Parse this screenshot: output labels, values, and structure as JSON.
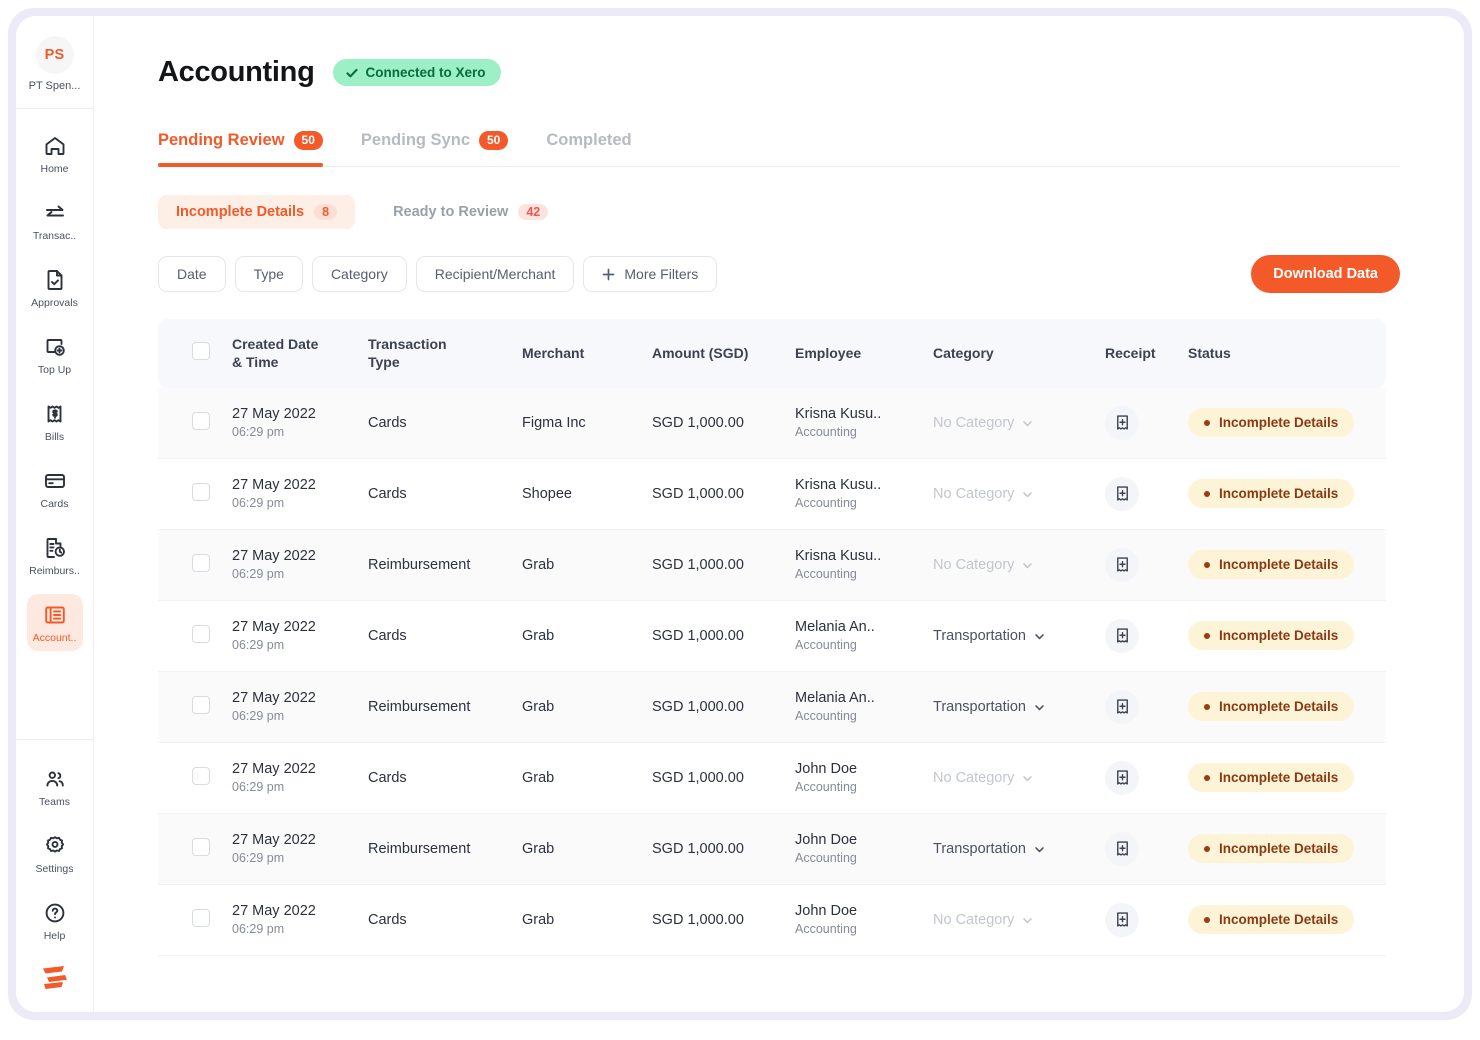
{
  "sidebar": {
    "org": {
      "initials": "PS",
      "name": "PT Spen..."
    },
    "items": [
      {
        "label": "Home",
        "icon": "home-icon",
        "active": false
      },
      {
        "label": "Transac..",
        "icon": "transfer-icon",
        "active": false
      },
      {
        "label": "Approvals",
        "icon": "document-check-icon",
        "active": false
      },
      {
        "label": "Top Up",
        "icon": "wallet-plus-icon",
        "active": false
      },
      {
        "label": "Bills",
        "icon": "receipt-dollar-icon",
        "active": false
      },
      {
        "label": "Cards",
        "icon": "card-icon",
        "active": false
      },
      {
        "label": "Reimburs..",
        "icon": "document-clock-icon",
        "active": false
      },
      {
        "label": "Account..",
        "icon": "accounting-icon",
        "active": true
      }
    ],
    "bottom_items": [
      {
        "label": "Teams",
        "icon": "people-icon"
      },
      {
        "label": "Settings",
        "icon": "gear-icon"
      },
      {
        "label": "Help",
        "icon": "help-circle-icon"
      }
    ],
    "brand": "spenmo-logo"
  },
  "header": {
    "title": "Accounting",
    "connection_badge": {
      "label": "Connected to Xero",
      "icon": "check-icon"
    }
  },
  "tabs": [
    {
      "label": "Pending Review",
      "count": "50",
      "active": true
    },
    {
      "label": "Pending Sync",
      "count": "50",
      "active": false
    },
    {
      "label": "Completed",
      "count": "",
      "active": false
    }
  ],
  "subtabs": [
    {
      "label": "Incomplete Details",
      "count": "8",
      "active": true
    },
    {
      "label": "Ready to Review",
      "count": "42",
      "active": false
    }
  ],
  "filters": [
    {
      "label": "Date",
      "icon": ""
    },
    {
      "label": "Type",
      "icon": ""
    },
    {
      "label": "Category",
      "icon": ""
    },
    {
      "label": "Recipient/Merchant",
      "icon": ""
    },
    {
      "label": "More Filters",
      "icon": "plus-icon"
    }
  ],
  "download_button": "Download Data",
  "table": {
    "columns": [
      "",
      "Created Date & Time",
      "Transaction Type",
      "Merchant",
      "Amount (SGD)",
      "Employee",
      "Category",
      "Receipt",
      "Status"
    ],
    "column_lines": {
      "created_date": [
        "Created Date",
        "& Time"
      ],
      "transaction_type": [
        "Transaction",
        "Type"
      ],
      "merchant": "Merchant",
      "amount": "Amount (SGD)",
      "employee": "Employee",
      "category": "Category",
      "receipt": "Receipt",
      "status": "Status"
    },
    "rows": [
      {
        "date": "27 May 2022",
        "time": "06:29 pm",
        "type": "Cards",
        "merchant": "Figma Inc",
        "amount": "SGD 1,000.00",
        "employee": "Krisna Kusu..",
        "dept": "Accounting",
        "category": "No Category",
        "category_empty": true,
        "receipt_icon": "add-receipt-icon",
        "status": "Incomplete Details"
      },
      {
        "date": "27 May 2022",
        "time": "06:29 pm",
        "type": "Cards",
        "merchant": "Shopee",
        "amount": "SGD 1,000.00",
        "employee": "Krisna Kusu..",
        "dept": "Accounting",
        "category": "No Category",
        "category_empty": true,
        "receipt_icon": "add-receipt-icon",
        "status": "Incomplete Details"
      },
      {
        "date": "27 May 2022",
        "time": "06:29 pm",
        "type": "Reimbursement",
        "merchant": "Grab",
        "amount": "SGD 1,000.00",
        "employee": "Krisna Kusu..",
        "dept": "Accounting",
        "category": "No Category",
        "category_empty": true,
        "receipt_icon": "add-receipt-icon",
        "status": "Incomplete Details"
      },
      {
        "date": "27 May 2022",
        "time": "06:29 pm",
        "type": "Cards",
        "merchant": "Grab",
        "amount": "SGD 1,000.00",
        "employee": "Melania An..",
        "dept": "Accounting",
        "category": "Transportation",
        "category_empty": false,
        "receipt_icon": "add-receipt-icon",
        "status": "Incomplete Details"
      },
      {
        "date": "27 May 2022",
        "time": "06:29 pm",
        "type": "Reimbursement",
        "merchant": "Grab",
        "amount": "SGD 1,000.00",
        "employee": "Melania An..",
        "dept": "Accounting",
        "category": "Transportation",
        "category_empty": false,
        "receipt_icon": "add-receipt-icon",
        "status": "Incomplete Details"
      },
      {
        "date": "27 May 2022",
        "time": "06:29 pm",
        "type": "Cards",
        "merchant": "Grab",
        "amount": "SGD 1,000.00",
        "employee": "John Doe",
        "dept": "Accounting",
        "category": "No Category",
        "category_empty": true,
        "receipt_icon": "add-receipt-icon",
        "status": "Incomplete Details"
      },
      {
        "date": "27 May 2022",
        "time": "06:29 pm",
        "type": "Reimbursement",
        "merchant": "Grab",
        "amount": "SGD 1,000.00",
        "employee": "John Doe",
        "dept": "Accounting",
        "category": "Transportation",
        "category_empty": false,
        "receipt_icon": "add-receipt-icon",
        "status": "Incomplete Details"
      },
      {
        "date": "27 May 2022",
        "time": "06:29 pm",
        "type": "Cards",
        "merchant": "Grab",
        "amount": "SGD 1,000.00",
        "employee": "John Doe",
        "dept": "Accounting",
        "category": "No Category",
        "category_empty": true,
        "receipt_icon": "add-receipt-icon",
        "status": "Incomplete Details"
      }
    ]
  },
  "colors": {
    "accent": "#f4592a",
    "accent_soft": "#fdeee6",
    "connected_bg": "#9defc6",
    "connected_text": "#0a6b41",
    "status_bg": "#fdf3d7",
    "status_text": "#8a3a12",
    "table_header_bg": "#f6f8fb"
  }
}
